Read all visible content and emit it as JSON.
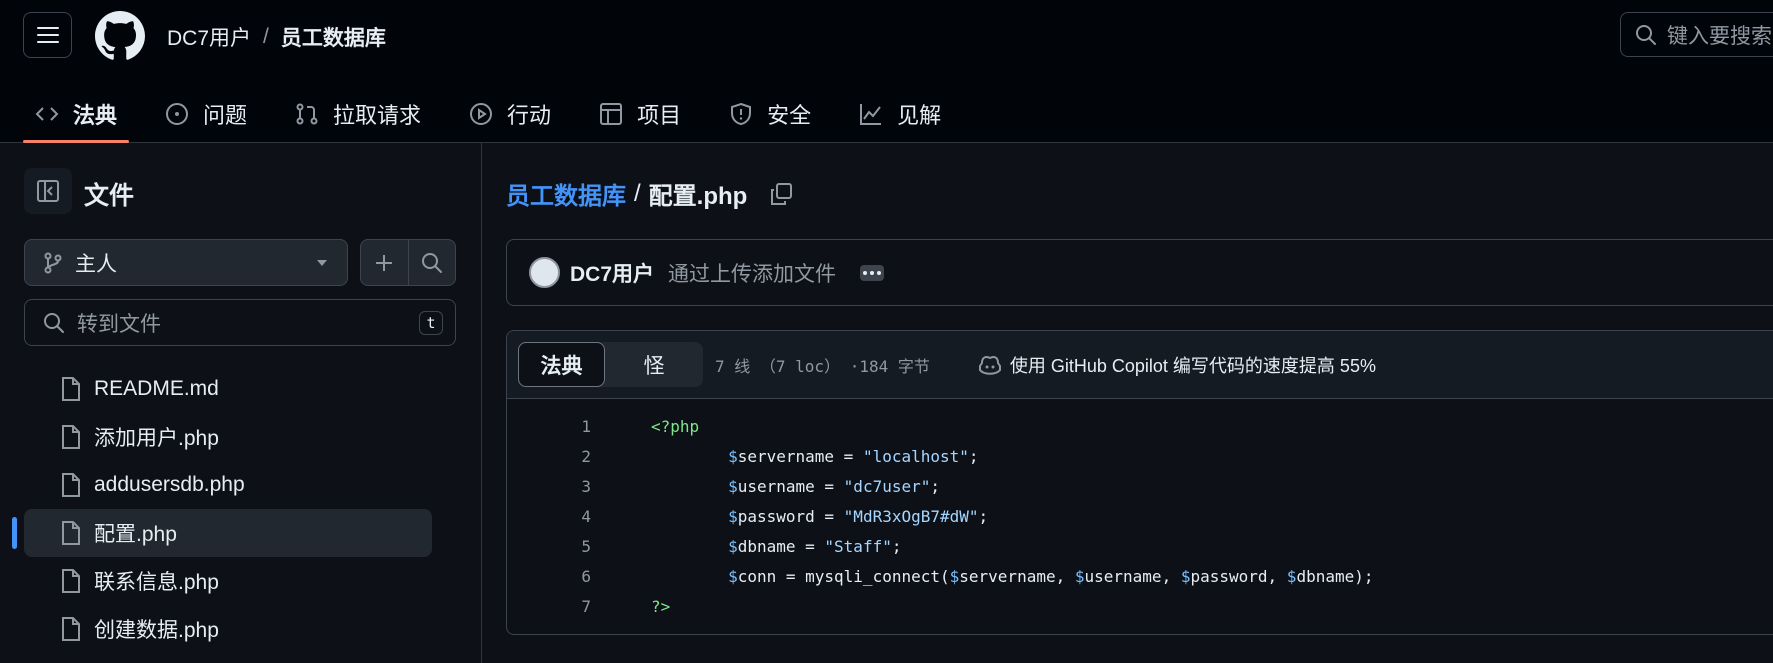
{
  "header": {
    "owner": "DC7用户",
    "separator": "/",
    "repo": "员工数据库",
    "search_placeholder": "键入要搜索"
  },
  "tabs": [
    {
      "label": "法典",
      "icon": "code-icon",
      "active": true
    },
    {
      "label": "问题",
      "icon": "issue-icon"
    },
    {
      "label": "拉取请求",
      "icon": "pull-request-icon"
    },
    {
      "label": "行动",
      "icon": "play-icon"
    },
    {
      "label": "项目",
      "icon": "table-icon"
    },
    {
      "label": "安全",
      "icon": "shield-icon"
    },
    {
      "label": "见解",
      "icon": "graph-icon"
    }
  ],
  "sidebar": {
    "title": "文件",
    "branch": "主人",
    "goto_placeholder": "转到文件",
    "goto_shortcut": "t",
    "files": [
      {
        "name": "README.md"
      },
      {
        "name": "添加用户.php"
      },
      {
        "name": "addusersdb.php"
      },
      {
        "name": "配置.php",
        "active": true
      },
      {
        "name": "联系信息.php"
      },
      {
        "name": "创建数据.php"
      }
    ]
  },
  "breadcrumb": {
    "repo": "员工数据库",
    "sep": "/",
    "file": "配置.php"
  },
  "commit": {
    "author": "DC7用户",
    "message": "通过上传添加文件"
  },
  "code_view": {
    "tab_code": "法典",
    "tab_blame": "怪",
    "meta": "7 线 （7 loc） ·184 字节",
    "copilot_text": "使用 GitHub Copilot 编写代码的速度提高 55%",
    "lines": [
      {
        "n": "1",
        "segments": [
          {
            "t": "<?php",
            "c": "kw"
          }
        ]
      },
      {
        "n": "2",
        "segments": [
          {
            "t": "        "
          },
          {
            "t": "$",
            "c": "var"
          },
          {
            "t": "servername = "
          },
          {
            "t": "\"localhost\"",
            "c": "str"
          },
          {
            "t": ";"
          }
        ]
      },
      {
        "n": "3",
        "segments": [
          {
            "t": "        "
          },
          {
            "t": "$",
            "c": "var"
          },
          {
            "t": "username = "
          },
          {
            "t": "\"dc7user\"",
            "c": "str"
          },
          {
            "t": ";"
          }
        ]
      },
      {
        "n": "4",
        "segments": [
          {
            "t": "        "
          },
          {
            "t": "$",
            "c": "var"
          },
          {
            "t": "password = "
          },
          {
            "t": "\"MdR3xOgB7#dW\"",
            "c": "str"
          },
          {
            "t": ";"
          }
        ]
      },
      {
        "n": "5",
        "segments": [
          {
            "t": "        "
          },
          {
            "t": "$",
            "c": "var"
          },
          {
            "t": "dbname = "
          },
          {
            "t": "\"Staff\"",
            "c": "str"
          },
          {
            "t": ";"
          }
        ]
      },
      {
        "n": "6",
        "segments": [
          {
            "t": "        "
          },
          {
            "t": "$",
            "c": "var"
          },
          {
            "t": "conn = mysqli_connect("
          },
          {
            "t": "$",
            "c": "var"
          },
          {
            "t": "servername, "
          },
          {
            "t": "$",
            "c": "var"
          },
          {
            "t": "username, "
          },
          {
            "t": "$",
            "c": "var"
          },
          {
            "t": "password, "
          },
          {
            "t": "$",
            "c": "var"
          },
          {
            "t": "dbname);"
          }
        ]
      },
      {
        "n": "7",
        "segments": [
          {
            "t": "?>",
            "c": "kw"
          }
        ]
      }
    ]
  }
}
